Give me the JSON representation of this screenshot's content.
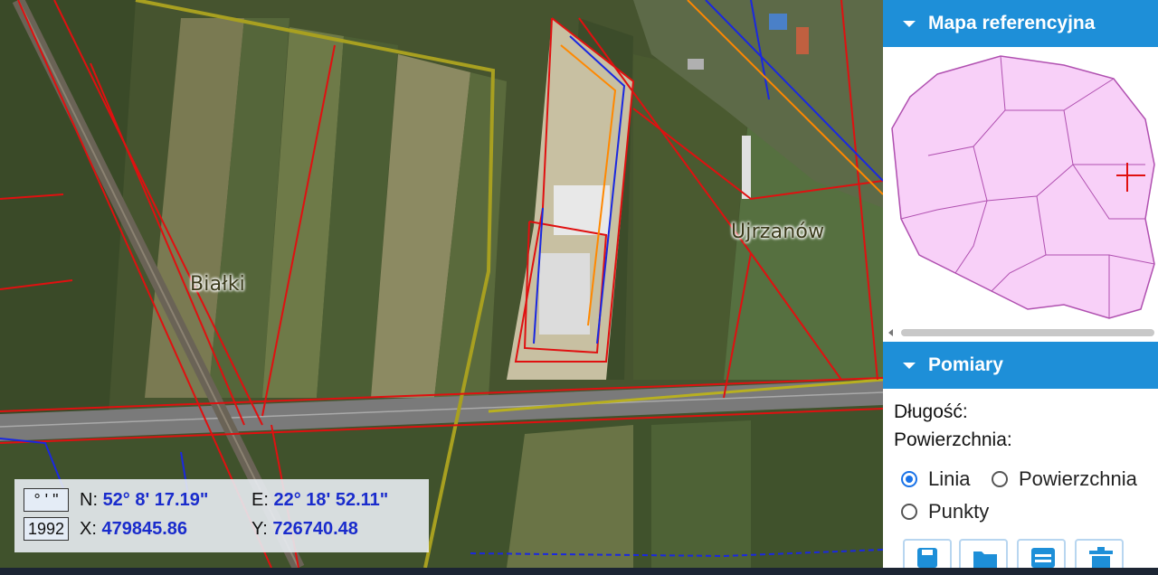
{
  "map": {
    "place_labels": [
      "Białki",
      "Ujrzanów"
    ]
  },
  "coords": {
    "format_button": "° ' \"",
    "system_button": "1992",
    "n_label": "N:",
    "n_value": "52° 8' 17.19\"",
    "e_label": "E:",
    "e_value": "22° 18' 52.11\"",
    "x_label": "X:",
    "x_value": "479845.86",
    "y_label": "Y:",
    "y_value": "726740.48"
  },
  "panel": {
    "ref_title": "Mapa referencyjna",
    "measure_title": "Pomiary",
    "length_label": "Długość:",
    "area_label": "Powierzchnia:",
    "radios": [
      {
        "label": "Linia",
        "checked": true
      },
      {
        "label": "Powierzchnia",
        "checked": false
      },
      {
        "label": "Punkty",
        "checked": false
      }
    ],
    "tools": [
      "save-icon",
      "folder-icon",
      "list-icon",
      "delete-icon"
    ]
  },
  "colors": {
    "header_blue": "#1e8fd8",
    "coord_blue": "#1a2ccc",
    "parcel_red": "#e01010",
    "utility_blue": "#1a28e0",
    "boundary_olive": "#a8a020",
    "region_pink": "#f8d0f8",
    "region_stroke": "#b050b0"
  }
}
